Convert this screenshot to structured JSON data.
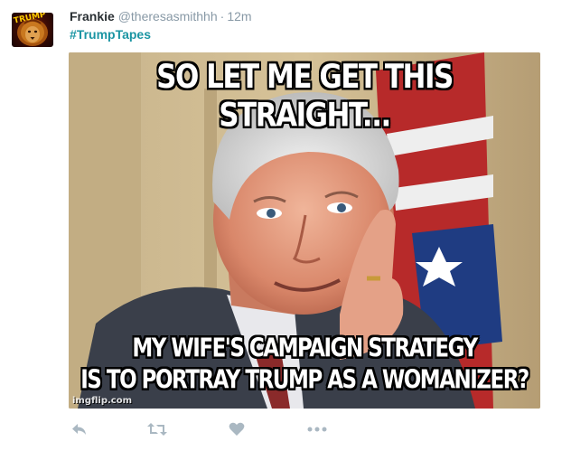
{
  "tweet": {
    "author": {
      "display_name": "Frankie",
      "screen_name": "@theresasmithhh",
      "avatar_text": "TRUMP",
      "avatar_icon": "lion-avatar"
    },
    "separator": "·",
    "timestamp": "12m",
    "hashtag": "#TrumpTapes",
    "media": {
      "top_caption": "SO LET ME GET THIS STRAIGHT...",
      "bottom_caption_line1": "MY WIFE'S CAMPAIGN STRATEGY",
      "bottom_caption_line2": "IS TO PORTRAY TRUMP AS A WOMANIZER?",
      "watermark": "imgflip.com"
    },
    "actions": {
      "reply_icon": "reply-icon",
      "retweet_icon": "retweet-icon",
      "like_icon": "heart-icon",
      "more_icon": "more-icon"
    },
    "colors": {
      "name": "#292f33",
      "muted": "#8899a6",
      "hashtag": "#1b95a3",
      "icon": "#aab8c2"
    }
  }
}
